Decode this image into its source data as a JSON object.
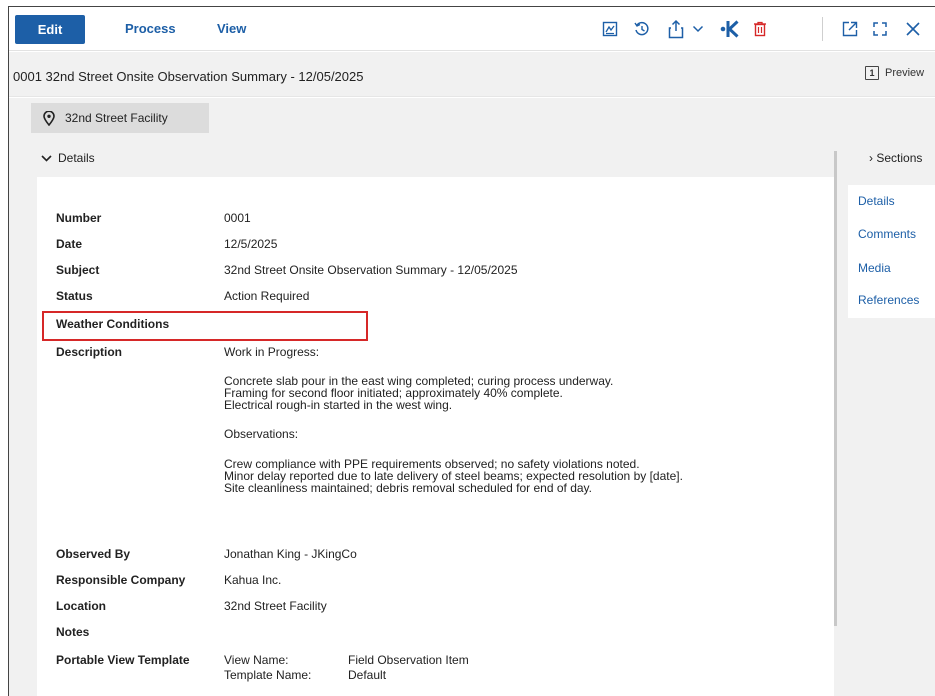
{
  "toolbar": {
    "edit_label": "Edit",
    "process_label": "Process",
    "view_label": "View",
    "icons": [
      "signature-icon",
      "history-icon",
      "share-icon",
      "chevron-down-icon",
      "kahua-icon",
      "delete-icon",
      "open-external-icon",
      "fullscreen-icon",
      "close-icon"
    ],
    "accent_color": "#1d5fa7",
    "delete_color": "#d62828"
  },
  "title": {
    "text": "0001 32nd Street Onsite Observation Summary - 12/05/2025",
    "preview_label": "Preview",
    "preview_badge": "1"
  },
  "location_chip": {
    "label": "32nd Street Facility"
  },
  "details": {
    "header": "Details",
    "fields": {
      "number_label": "Number",
      "number_value": "0001",
      "date_label": "Date",
      "date_value": "12/5/2025",
      "subject_label": "Subject",
      "subject_value": "32nd Street Onsite Observation Summary - 12/05/2025",
      "status_label": "Status",
      "status_value": "Action Required",
      "weather_label": "Weather Conditions",
      "description_label": "Description",
      "description_lines": [
        "Work in Progress:",
        "",
        "Concrete slab pour in the east wing completed; curing process underway.",
        "Framing for second floor initiated; approximately 40% complete.",
        "Electrical rough-in started in the west wing.",
        "",
        "Observations:",
        "",
        "Crew compliance with PPE requirements observed; no safety violations noted.",
        "Minor delay reported due to late delivery of steel beams; expected resolution by [date].",
        "Site cleanliness maintained; debris removal scheduled for end of day."
      ],
      "observed_by_label": "Observed By",
      "observed_by_value": "Jonathan King - JKingCo",
      "responsible_company_label": "Responsible Company",
      "responsible_company_value": "Kahua Inc.",
      "location_label": "Location",
      "location_value": "32nd Street Facility",
      "notes_label": "Notes",
      "portable_label": "Portable View Template",
      "view_name_label": "View Name:",
      "view_name_value": "Field Observation Item",
      "template_name_label": "Template Name:",
      "template_name_value": "Default"
    }
  },
  "sections": {
    "toggle_label": "Sections",
    "items": [
      "Details",
      "Comments",
      "Media",
      "References"
    ]
  }
}
